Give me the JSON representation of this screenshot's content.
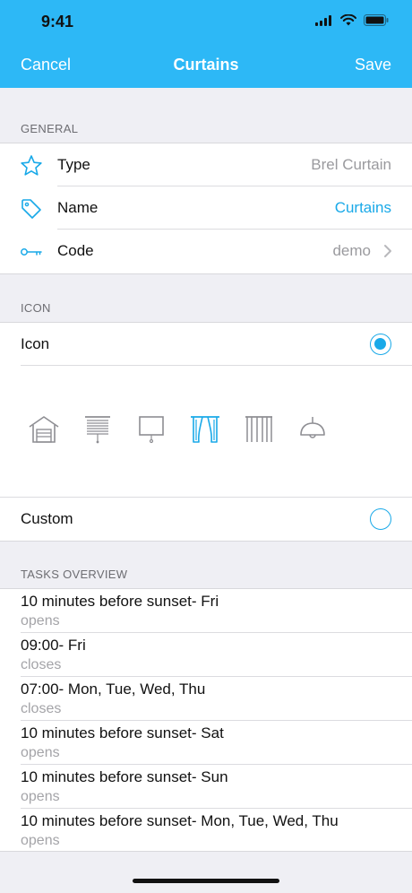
{
  "status": {
    "time": "9:41"
  },
  "nav": {
    "cancel": "Cancel",
    "title": "Curtains",
    "save": "Save"
  },
  "general": {
    "header": "GENERAL",
    "rows": [
      {
        "label": "Type",
        "value": "Brel Curtain",
        "icon": "star-icon"
      },
      {
        "label": "Name",
        "value": "Curtains",
        "icon": "tag-icon"
      },
      {
        "label": "Code",
        "value": "demo",
        "icon": "key-icon"
      }
    ]
  },
  "icon_section": {
    "header": "ICON",
    "icon_label": "Icon",
    "custom_label": "Custom",
    "icon_selected": true,
    "custom_selected": false,
    "choices": [
      "garage-icon",
      "blind-icon",
      "screen-icon",
      "curtain-icon",
      "vertical-blind-icon",
      "lamp-icon"
    ],
    "selected_choice": "curtain-icon",
    "accent": "#19a9e8"
  },
  "tasks": {
    "header": "TASKS OVERVIEW",
    "items": [
      {
        "title": "10 minutes before sunset- Fri",
        "action": "opens"
      },
      {
        "title": "09:00- Fri",
        "action": "closes"
      },
      {
        "title": "07:00- Mon, Tue, Wed, Thu",
        "action": "closes"
      },
      {
        "title": "10 minutes before sunset- Sat",
        "action": "opens"
      },
      {
        "title": "10 minutes before sunset- Sun",
        "action": "opens"
      },
      {
        "title": "10 minutes before sunset- Mon, Tue, Wed, Thu",
        "action": "opens"
      }
    ]
  }
}
